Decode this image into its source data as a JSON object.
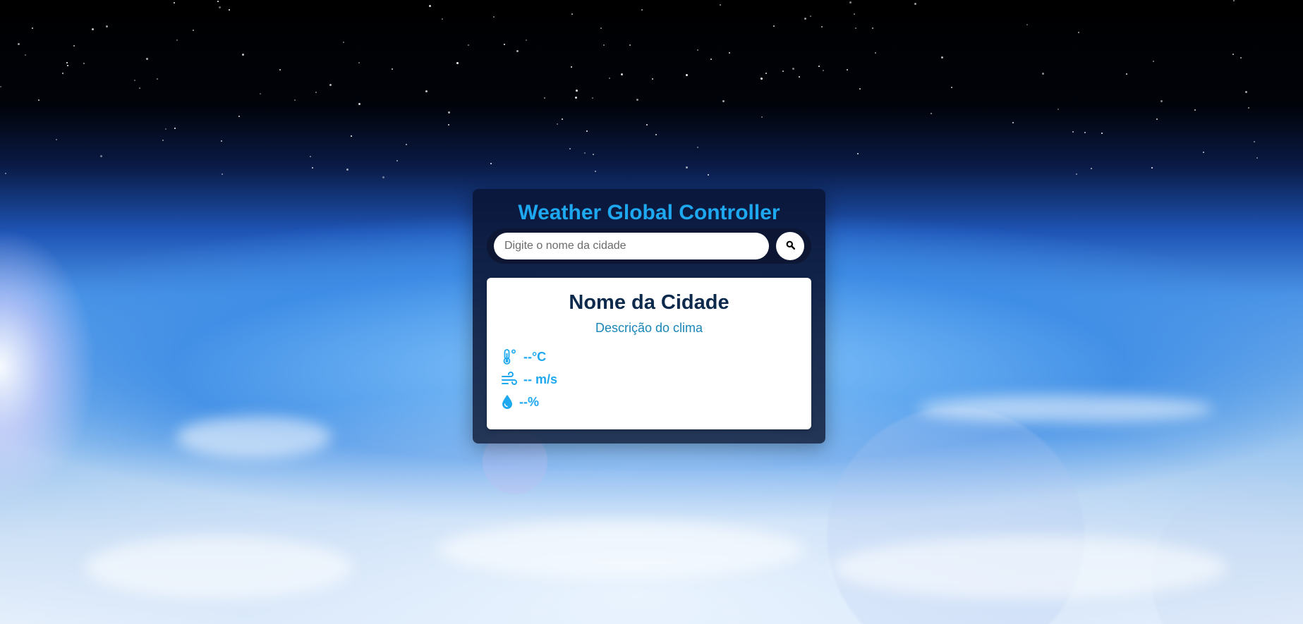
{
  "app": {
    "title": "Weather Global Controller"
  },
  "search": {
    "placeholder": "Digite o nome da cidade",
    "value": "",
    "button_icon": "search-icon"
  },
  "weather": {
    "city": "Nome da Cidade",
    "description": "Descrição do clima",
    "temperature": "--°C",
    "temperature_icon": "thermometer-icon",
    "wind": "-- m/s",
    "wind_icon": "wind-icon",
    "humidity": "--%",
    "humidity_icon": "water-drop-icon"
  },
  "colors": {
    "accent": "#1da8f0",
    "city_text": "#0d2a4d",
    "description_text": "#1a86b8",
    "panel_background": "#0a163a",
    "card_background": "#ffffff"
  }
}
